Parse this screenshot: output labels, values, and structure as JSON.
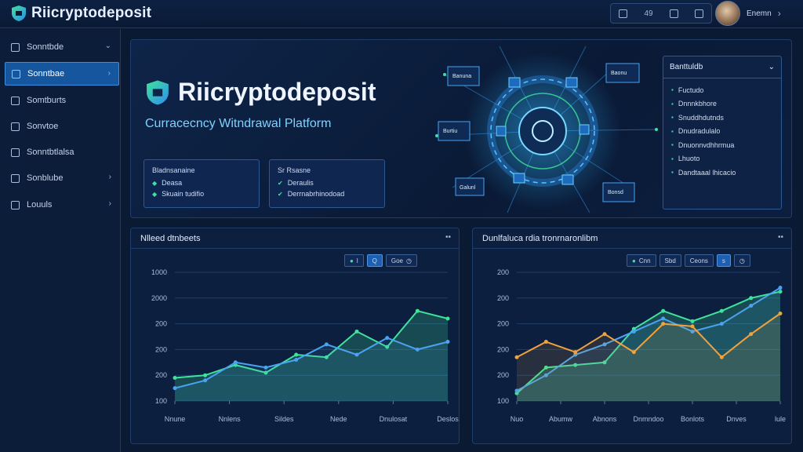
{
  "app": {
    "brand": "Riicryptodeposit",
    "top_actions": {
      "item_1_value": "49"
    },
    "user": {
      "name": "Enemn"
    }
  },
  "sidebar": {
    "items": [
      {
        "label": "Sonntbde",
        "icon": "wallet-icon"
      },
      {
        "label": "Sonntbae",
        "icon": "dashboard-icon"
      },
      {
        "label": "Somtburts",
        "icon": "chart-icon"
      },
      {
        "label": "Sonvtoe",
        "icon": "transfer-icon"
      },
      {
        "label": "Sonntbtlalsa",
        "icon": "list-icon"
      },
      {
        "label": "Sonblube",
        "icon": "settings-icon"
      },
      {
        "label": "Louuls",
        "icon": "document-icon"
      }
    ]
  },
  "hero": {
    "title": "Riicryptodeposit",
    "subtitle": "Curracecncy Witndrawal Platform",
    "box_left": {
      "title": "Bladnsanaine",
      "rows": [
        "Deasa",
        "Skuain tudifio"
      ]
    },
    "box_right": {
      "title": "Sr Rsasne",
      "rows": [
        "Deraulis",
        "Derrnabrhinodoad"
      ]
    },
    "nodes": [
      "Banuna",
      "Burtiu",
      "Galunl",
      "Baonu",
      "Bonsd"
    ],
    "panel": {
      "title": "Banttuldb",
      "rows": [
        "Fuctudo",
        "Dnnnkbhore",
        "Snuddhdutnds",
        "Dnudradulalo",
        "Dnuonnvdhhrmua",
        "Lhuoto",
        "Dandtaaal lhicacio"
      ]
    }
  },
  "chart_left": {
    "title": "Nlleed dtnbeets",
    "controls": [
      "l",
      "Q",
      "Goe"
    ]
  },
  "chart_right": {
    "title": "Dunlfaluca rdia tronrnaronlibm",
    "controls": [
      "Cnn",
      "Sbd",
      "Ceons",
      "s"
    ]
  },
  "chart_data": [
    {
      "type": "area",
      "title": "Nlleed dtnbeets",
      "xlabel": "",
      "ylabel": "",
      "categories": [
        "Nnune",
        "Nnlens",
        "Sildes",
        "Nede",
        "Dnulosat",
        "Deslos"
      ],
      "yticks": [
        "100",
        "200",
        "200",
        "200",
        "2000",
        "1000"
      ],
      "ylim": [
        0,
        100
      ],
      "series": [
        {
          "color": "#3fe39a",
          "values": [
            18,
            20,
            28,
            22,
            36,
            34,
            54,
            42,
            70,
            64
          ]
        },
        {
          "color": "#4aa3f0",
          "values": [
            10,
            16,
            30,
            26,
            32,
            44,
            36,
            49,
            40,
            46
          ]
        }
      ]
    },
    {
      "type": "area",
      "title": "Dunlfaluca rdia tronrnaronlibm",
      "xlabel": "",
      "ylabel": "",
      "categories": [
        "Nuo",
        "Abumw",
        "Abnons",
        "Dnmndoo",
        "Bonlots",
        "Dnves",
        "lule"
      ],
      "yticks": [
        "100",
        "200",
        "200",
        "200",
        "200",
        "200"
      ],
      "ylim": [
        0,
        100
      ],
      "series": [
        {
          "color": "#3fe39a",
          "values": [
            6,
            26,
            28,
            30,
            56,
            70,
            62,
            70,
            80,
            85
          ]
        },
        {
          "color": "#4aa3f0",
          "values": [
            8,
            20,
            36,
            44,
            54,
            64,
            54,
            60,
            74,
            88
          ]
        },
        {
          "color": "#f0a23c",
          "values": [
            34,
            46,
            38,
            52,
            38,
            60,
            58,
            34,
            52,
            68
          ]
        }
      ]
    }
  ]
}
